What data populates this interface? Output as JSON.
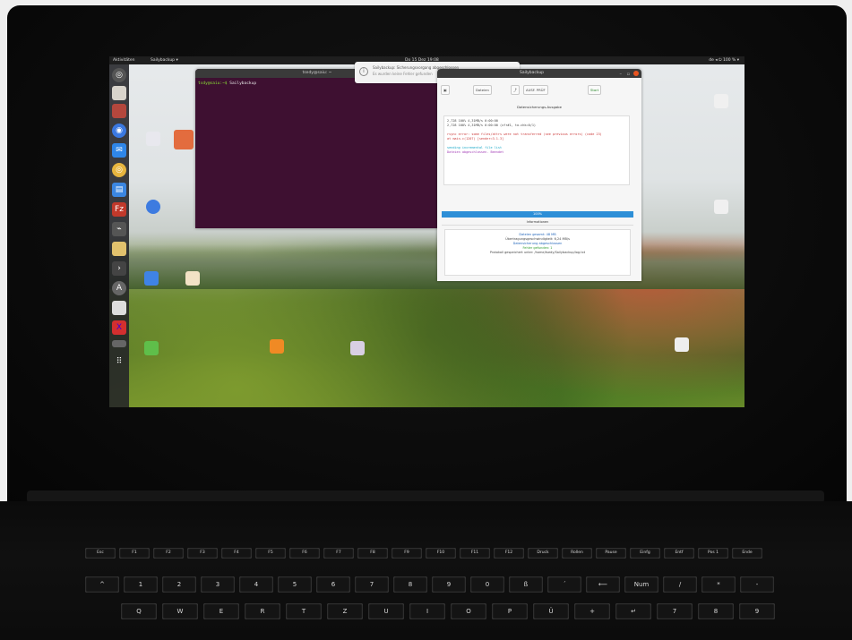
{
  "topbar": {
    "activities": "Aktivitäten",
    "app": "Sailybackup ▾",
    "clock": "Do 15 Dez 19:08",
    "tray": "de ◂ ⏻ 100 % ▾"
  },
  "terminal": {
    "title": "tsedy@saiu: ~",
    "prompt_user": "tsdy@saiu:~$",
    "prompt_cmd": "Sailybackup"
  },
  "notification": {
    "line1": "Sailybackup: Sicherungsvorgang abgeschlossen",
    "line2": "Es wurden keine Fehler gefunden"
  },
  "tool_window": {
    "title": "Sailybackup",
    "toolbar": [
      "▣",
      "Dateien",
      "⤴",
      "AUSF. PRÜF",
      "Start"
    ],
    "output_header": "Datensicherungs-Ausgabe",
    "output_lines": [
      "2,728 100%  4,31MB/s  0:00:00",
      "2,728 100%  4,31MB/s  0:00:00 (xfr#1, to-chk=0/1)"
    ],
    "error_lines": [
      "rsync error: some files/attrs were not transferred (see previous errors) (code 23)",
      "at main.c(1207) [sender=3.1.3]"
    ],
    "cyan_line": "sending incremental file list",
    "purple_line": "Dateien abgeschlossen. Beendet",
    "progress_label": "100%",
    "info_header": "Informationen",
    "info_lines": [
      "Dateien gesamt: 48 MB",
      "Übertragungsgeschwindigkeit: 6,24 MB/s",
      "Datensicherung abgeschlossen",
      "Fehler gefunden: 1",
      "Protokoll gespeichert unter: /home/tsedy/Sailybackup/log.txt"
    ]
  },
  "keyboard": {
    "fn_row": [
      "Esc",
      "F1",
      "F2",
      "F3",
      "F4",
      "F5",
      "F6",
      "F7",
      "F8",
      "F9",
      "F10",
      "F11",
      "F12",
      "Druck",
      "Rollen",
      "Pause",
      "Einfg",
      "Entf",
      "Pos 1",
      "Ende"
    ],
    "num_row": [
      "^",
      "1",
      "2",
      "3",
      "4",
      "5",
      "6",
      "7",
      "8",
      "9",
      "0",
      "ß",
      "´",
      "⟵",
      "Num",
      "/",
      "*",
      "-"
    ],
    "q_row": [
      "Q",
      "W",
      "E",
      "R",
      "T",
      "Z",
      "U",
      "I",
      "O",
      "P",
      "Ü",
      "+",
      "↵",
      "7",
      "8",
      "9"
    ]
  }
}
